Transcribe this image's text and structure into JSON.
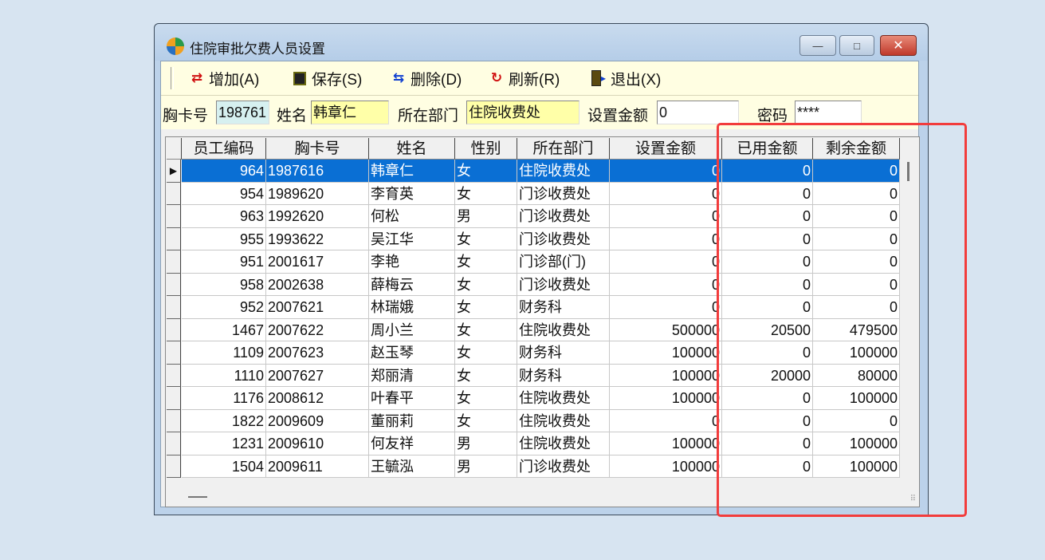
{
  "window": {
    "title": "住院审批欠费人员设置",
    "controls": {
      "minimize": "—",
      "maximize": "□",
      "close": "✕"
    }
  },
  "toolbar": {
    "add_label": "增加(A)",
    "save_label": "保存(S)",
    "delete_label": "删除(D)",
    "refresh_label": "刷新(R)",
    "exit_label": "退出(X)"
  },
  "form": {
    "badge_label": "胸卡号",
    "badge_value": "198761",
    "name_label": "姓名",
    "name_value": "韩章仁",
    "dept_label": "所在部门",
    "dept_value": "住院收费处",
    "amount_label": "设置金额",
    "amount_value": "0",
    "password_label": "密码",
    "password_value": "****"
  },
  "grid": {
    "columns": [
      "员工编码",
      "胸卡号",
      "姓名",
      "性别",
      "所在部门",
      "设置金额",
      "已用金额",
      "剩余金额"
    ],
    "selected_index": 0,
    "rows": [
      [
        "964",
        "1987616",
        "韩章仁",
        "女",
        "住院收费处",
        "0",
        "0",
        "0"
      ],
      [
        "954",
        "1989620",
        "李育英",
        "女",
        "门诊收费处",
        "0",
        "0",
        "0"
      ],
      [
        "963",
        "1992620",
        "何松",
        "男",
        "门诊收费处",
        "0",
        "0",
        "0"
      ],
      [
        "955",
        "1993622",
        "吴江华",
        "女",
        "门诊收费处",
        "0",
        "0",
        "0"
      ],
      [
        "951",
        "2001617",
        "李艳",
        "女",
        "门诊部(门)",
        "0",
        "0",
        "0"
      ],
      [
        "958",
        "2002638",
        "薛梅云",
        "女",
        "门诊收费处",
        "0",
        "0",
        "0"
      ],
      [
        "952",
        "2007621",
        "林瑞娥",
        "女",
        "财务科",
        "0",
        "0",
        "0"
      ],
      [
        "1467",
        "2007622",
        "周小兰",
        "女",
        "住院收费处",
        "500000",
        "20500",
        "479500"
      ],
      [
        "1109",
        "2007623",
        "赵玉琴",
        "女",
        "财务科",
        "100000",
        "0",
        "100000"
      ],
      [
        "1110",
        "2007627",
        "郑丽清",
        "女",
        "财务科",
        "100000",
        "20000",
        "80000"
      ],
      [
        "1176",
        "2008612",
        "叶春平",
        "女",
        "住院收费处",
        "100000",
        "0",
        "100000"
      ],
      [
        "1822",
        "2009609",
        "董丽莉",
        "女",
        "住院收费处",
        "0",
        "0",
        "0"
      ],
      [
        "1231",
        "2009610",
        "何友祥",
        "男",
        "住院收费处",
        "100000",
        "0",
        "100000"
      ],
      [
        "1504",
        "2009611",
        "王毓泓",
        "男",
        "门诊收费处",
        "100000",
        "0",
        "100000"
      ]
    ]
  },
  "colors": {
    "selection": "#0a6fd4",
    "annotation": "#f23c3c",
    "toolbar_bg": "#fffee2",
    "yellow_field": "#ffffa8",
    "cyan_field": "#d6f0f0"
  }
}
